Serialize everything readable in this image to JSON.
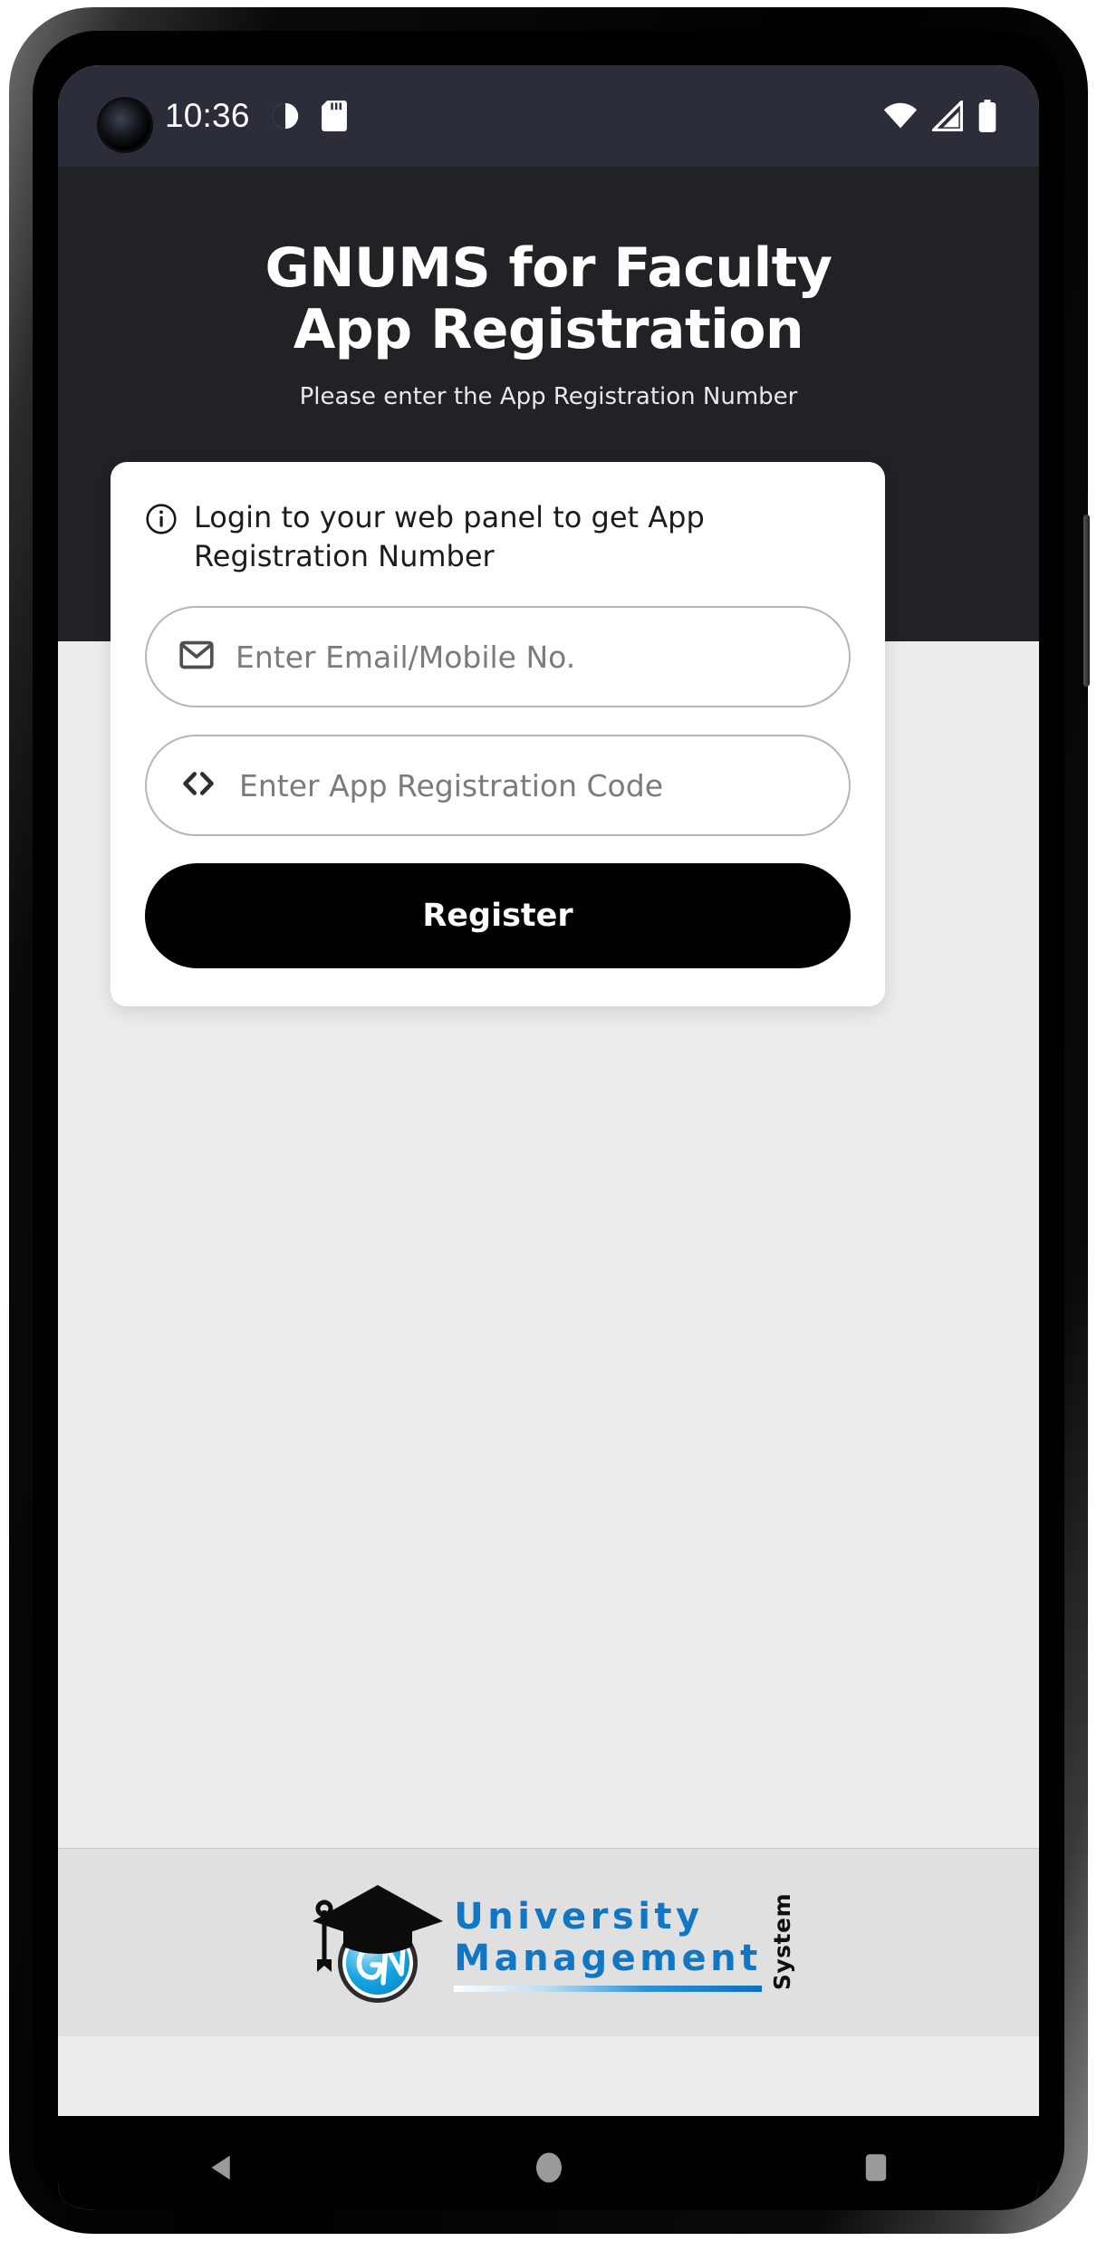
{
  "status_bar": {
    "time": "10:36",
    "icons_left": [
      "notification-dot-icon",
      "sd-card-icon"
    ],
    "icons_right": [
      "wifi-icon",
      "cellular-signal-icon",
      "battery-icon"
    ],
    "background_color": "#2b2d39"
  },
  "header": {
    "title_line1": "GNUMS for Faculty",
    "title_line2": "App Registration",
    "subtitle": "Please enter the App Registration Number",
    "background_color": "#212226",
    "text_color": "#ffffff"
  },
  "card": {
    "note_icon": "info-icon",
    "note_text": "Login to your web panel to get App Registration Number",
    "fields": [
      {
        "name": "email-or-mobile",
        "icon": "envelope-icon",
        "placeholder": "Enter Email/Mobile No.",
        "value": ""
      },
      {
        "name": "app-registration-code",
        "icon": "code-brackets-icon",
        "placeholder": "Enter App Registration Code",
        "value": ""
      }
    ],
    "submit_label": "Register",
    "submit_background": "#000000",
    "background_color": "#ffffff"
  },
  "body": {
    "background_color": "#ededed"
  },
  "footer": {
    "logo_mark": "graduation-cap-gn-logo",
    "word_line1": "University",
    "word_line2": "Management",
    "word_side": "System",
    "brand_color": "#1176c4",
    "background_color": "#e0e0e0"
  },
  "nav_bar": {
    "buttons": [
      "back-button",
      "home-button",
      "recents-button"
    ],
    "background_color": "#000000",
    "icon_color": "#9a9a9a"
  }
}
